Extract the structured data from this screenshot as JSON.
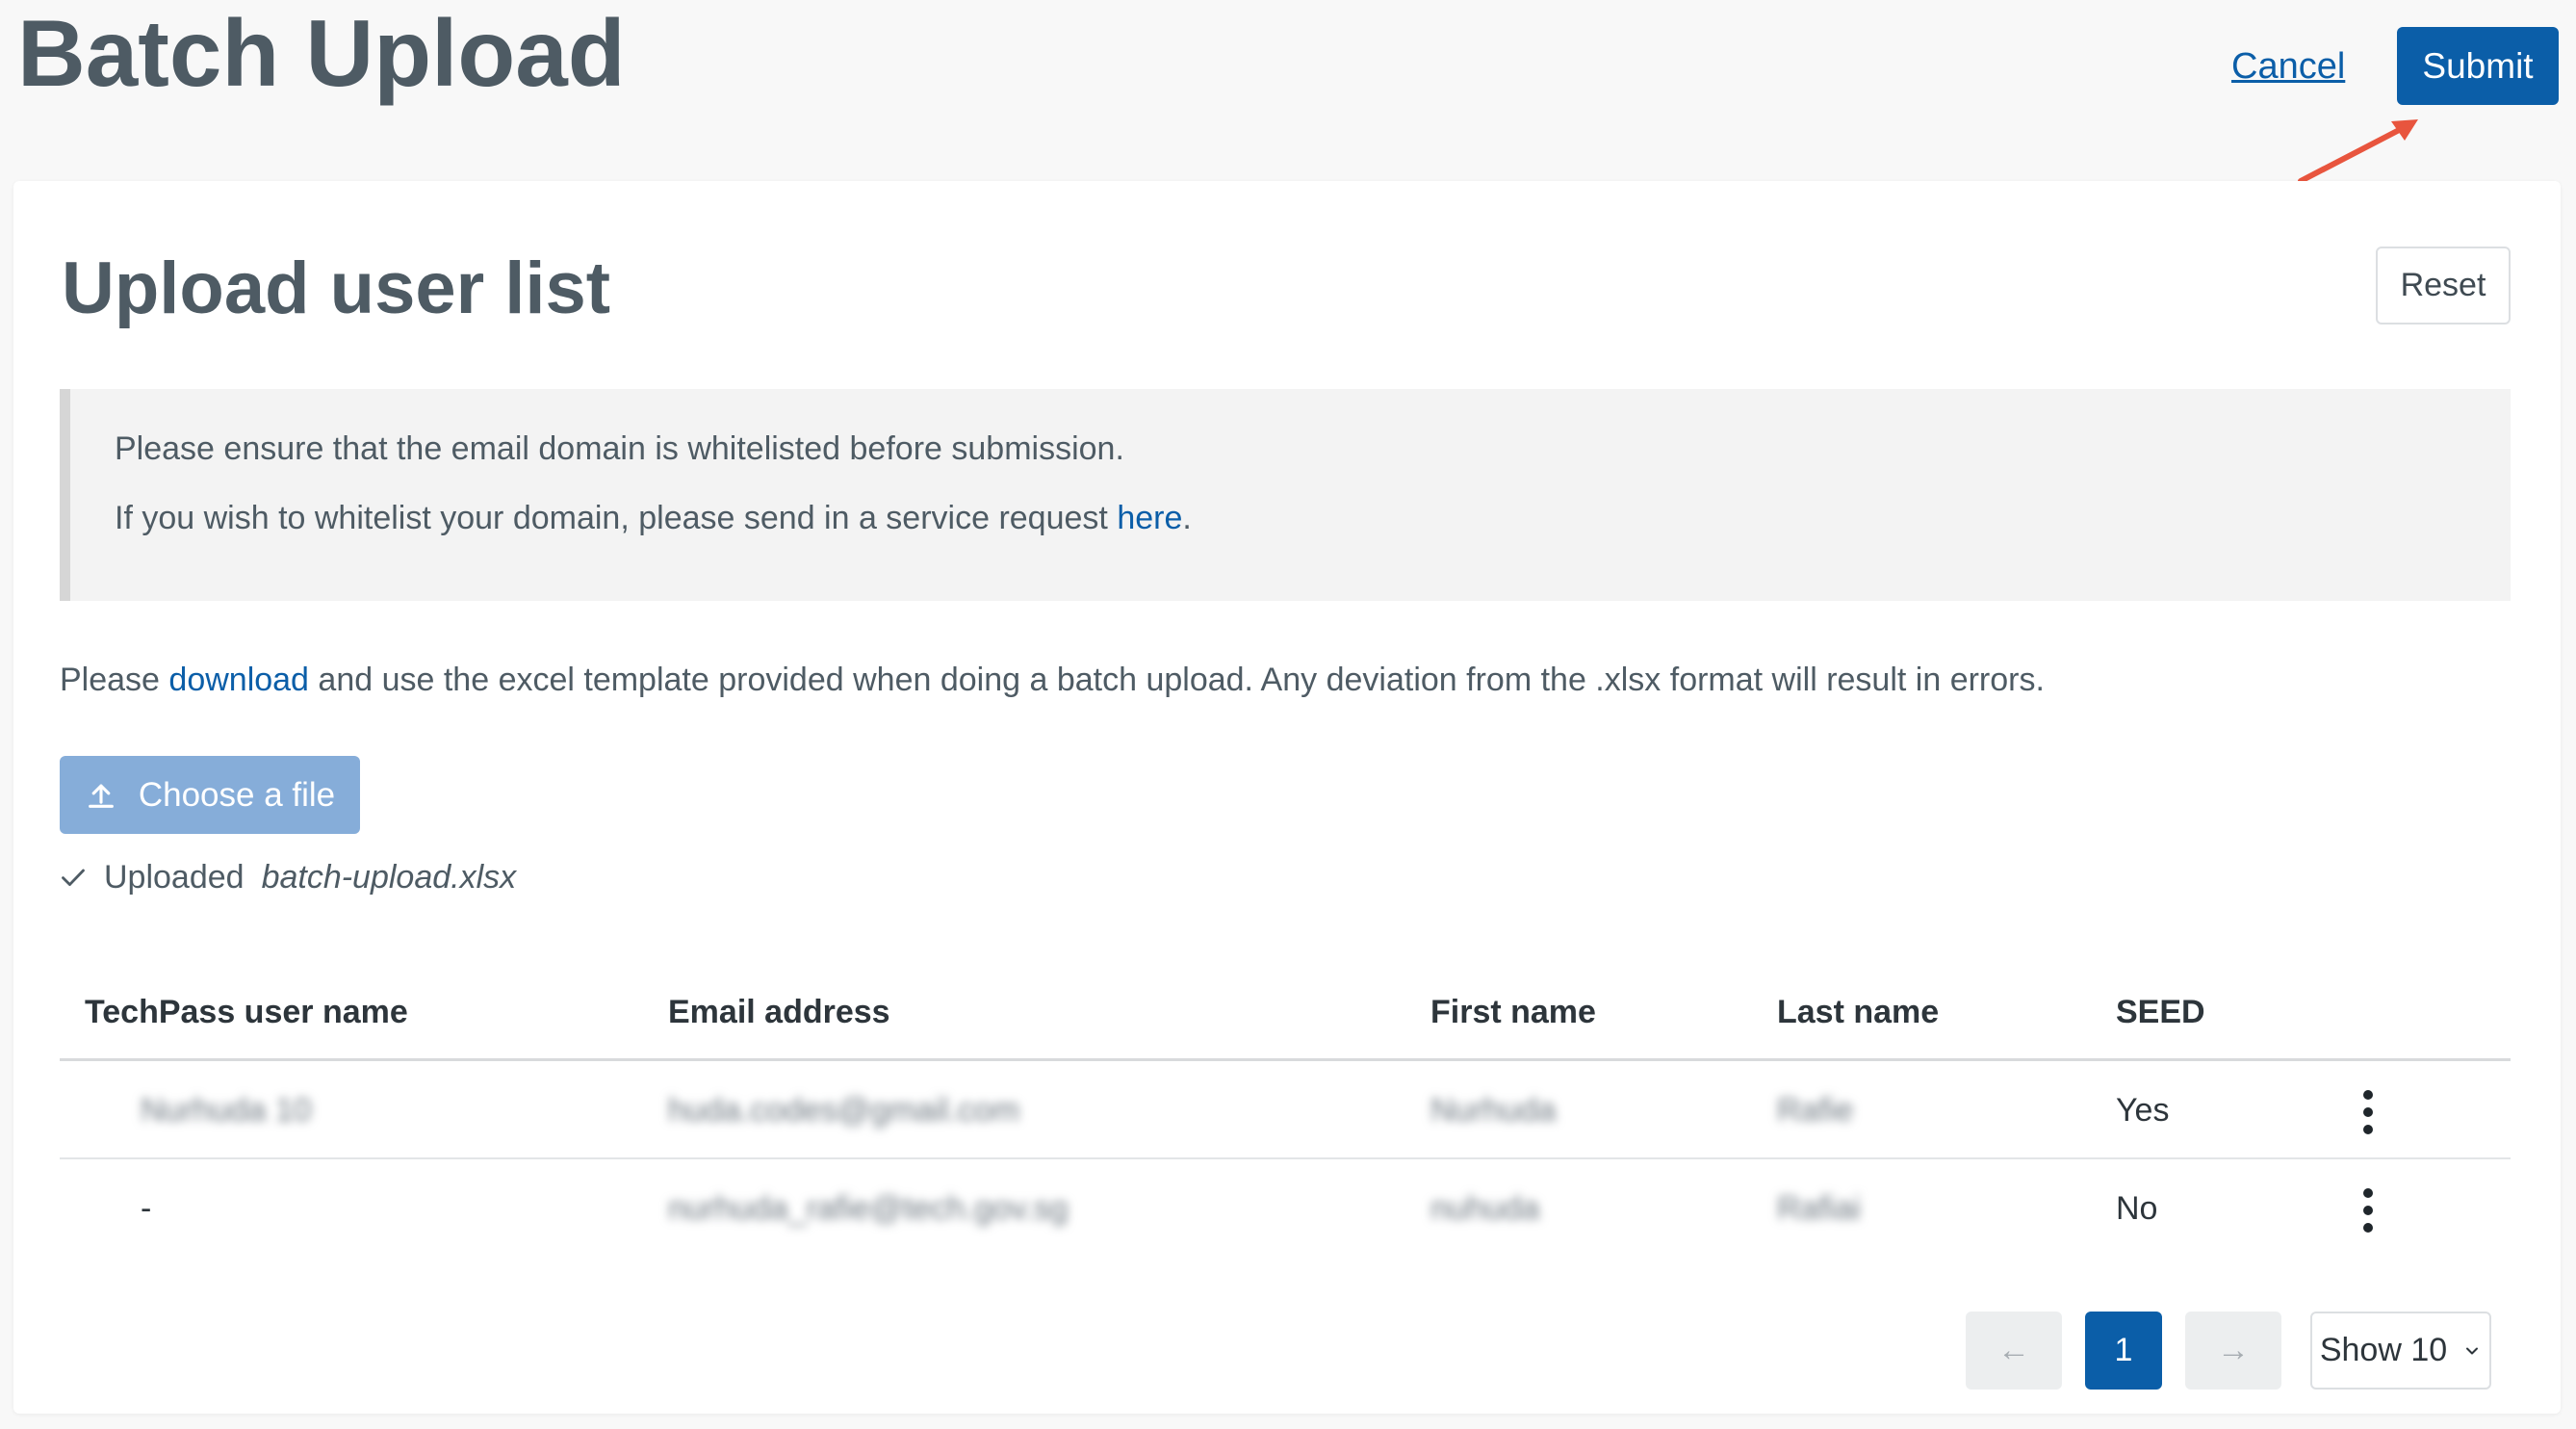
{
  "header": {
    "title": "Batch Upload",
    "cancel_label": "Cancel",
    "submit_label": "Submit"
  },
  "card": {
    "title": "Upload user list",
    "reset_label": "Reset",
    "notice": {
      "line1": "Please ensure that the email domain is whitelisted before submission.",
      "line2_before": "If you wish to whitelist your domain, please send in a service request ",
      "line2_link": "here",
      "line2_after": "."
    },
    "description": {
      "before": "Please ",
      "link": "download",
      "after": " and use the excel template provided when doing a batch upload. Any deviation from the .xlsx format will result in errors."
    },
    "choose_file_label": "Choose a file",
    "uploaded": {
      "prefix": "Uploaded",
      "filename": "batch-upload.xlsx"
    }
  },
  "table": {
    "columns": [
      "TechPass user name",
      "Email address",
      "First name",
      "Last name",
      "SEED"
    ],
    "rows": [
      {
        "username": "Nurhuda 10",
        "email": "huda.codes@gmail.com",
        "first": "Nurhuda",
        "last": "Rafie",
        "seed": "Yes"
      },
      {
        "username": "-",
        "email": "nurhuda_rafie@tech.gov.sg",
        "first": "nuhuda",
        "last": "Rafiai",
        "seed": "No"
      }
    ]
  },
  "pagination": {
    "prev_arrow": "←",
    "current_page": "1",
    "next_arrow": "→",
    "show_label": "Show 10"
  },
  "colors": {
    "primary": "#0b5ea8",
    "primary_disabled": "#86add9",
    "annotation_arrow": "#e8553e"
  },
  "icons": [
    "upload-icon",
    "check-icon",
    "kebab-menu-icon",
    "chevron-down-icon",
    "arrow-left-icon",
    "arrow-right-icon"
  ]
}
